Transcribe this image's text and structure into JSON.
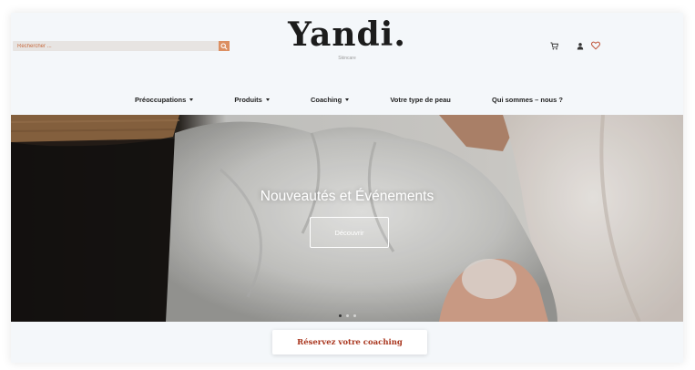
{
  "search": {
    "placeholder": "Rechercher ..."
  },
  "brand": {
    "name": "Yandi.",
    "tagline": "Skincare"
  },
  "header_icons": [
    "cart-icon",
    "user-icon",
    "heart-icon"
  ],
  "nav": {
    "items": [
      {
        "label": "Préoccupations",
        "dropdown": true
      },
      {
        "label": "Produits",
        "dropdown": true
      },
      {
        "label": "Coaching",
        "dropdown": true
      },
      {
        "label": "Votre type de peau",
        "dropdown": false
      },
      {
        "label": "Qui sommes – nous ?",
        "dropdown": false
      }
    ]
  },
  "hero": {
    "title": "Nouveautés et Événements",
    "button_label": "Découvrir",
    "slides_count": 3,
    "active_slide": 1
  },
  "cta": {
    "label": "Réservez votre coaching"
  },
  "colors": {
    "accent": "#a8341c",
    "search_button": "#dc8f62",
    "heart": "#c0553a",
    "background": "#f4f7fa"
  }
}
